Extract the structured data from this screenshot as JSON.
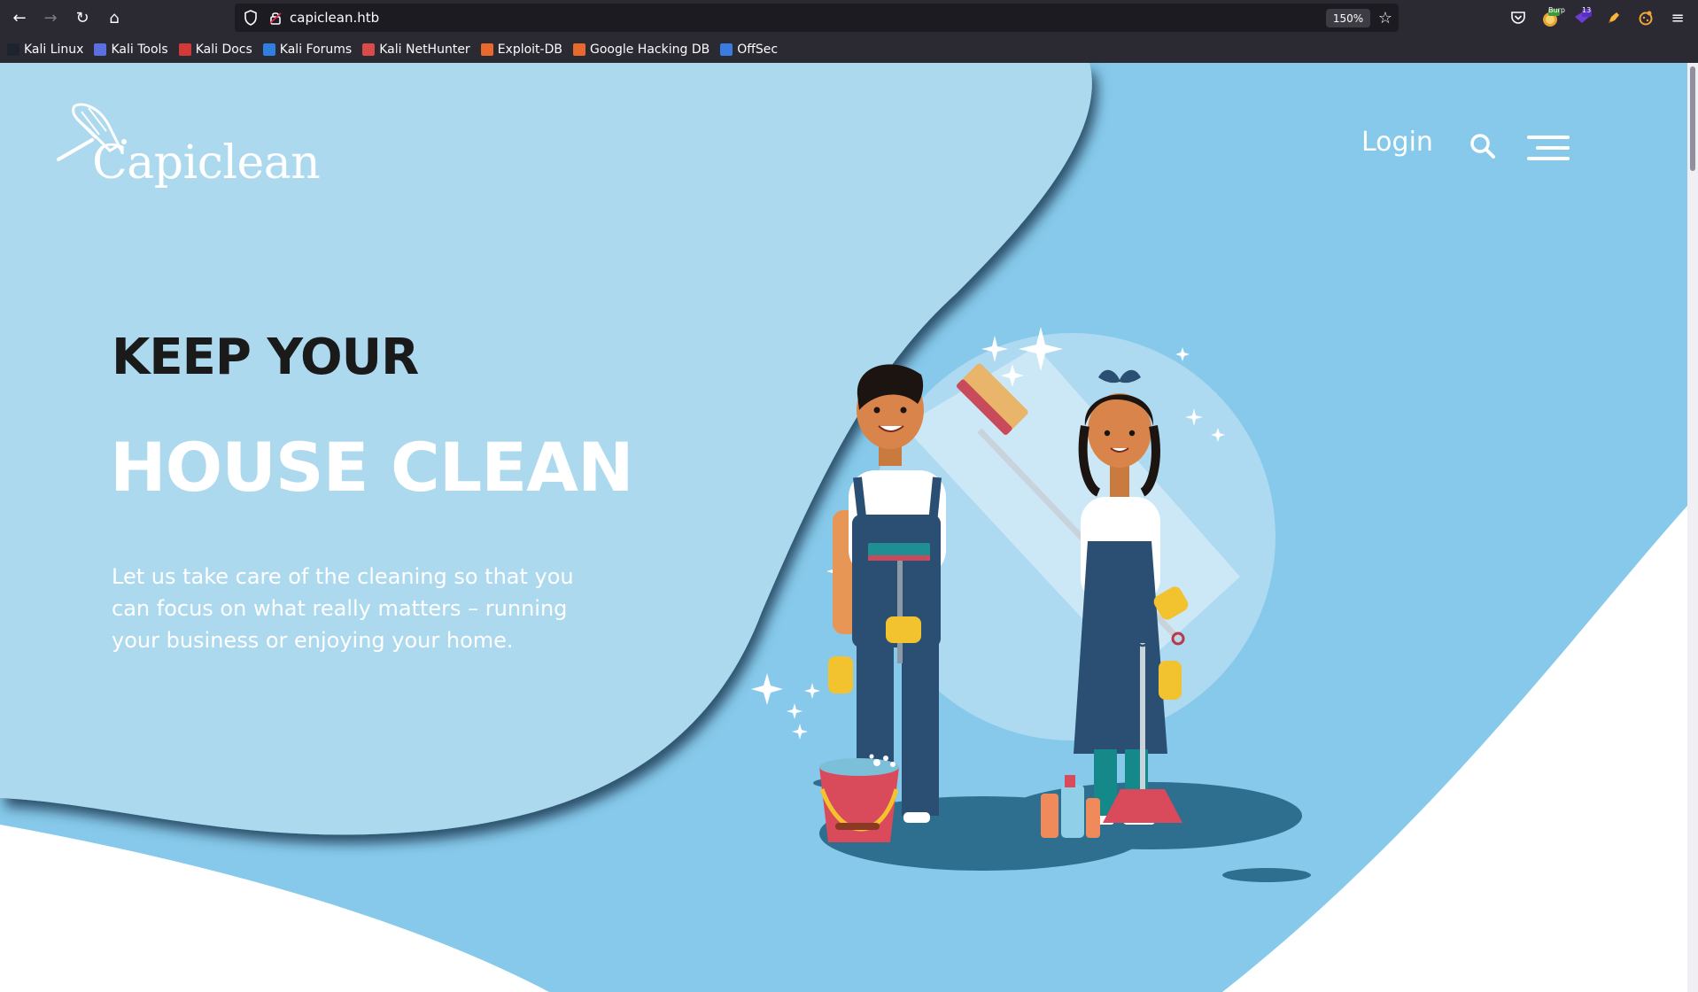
{
  "browser": {
    "url": "capiclean.htb",
    "zoom": "150%",
    "extensions": [
      {
        "name": "pocket-icon"
      },
      {
        "name": "burp-extension-icon",
        "badge": "Burp"
      },
      {
        "name": "extension-badge-icon",
        "badge": "13"
      },
      {
        "name": "pencil-extension-icon"
      },
      {
        "name": "cookie-extension-icon"
      }
    ],
    "bookmarks": [
      {
        "label": "Kali Linux",
        "color": "#2d6cdf"
      },
      {
        "label": "Kali Tools",
        "color": "#5a6fe0"
      },
      {
        "label": "Kali Docs",
        "color": "#d23a3a"
      },
      {
        "label": "Kali Forums",
        "color": "#2f7fe0"
      },
      {
        "label": "Kali NetHunter",
        "color": "#d94a4a"
      },
      {
        "label": "Exploit-DB",
        "color": "#e8692e"
      },
      {
        "label": "Google Hacking DB",
        "color": "#e8692e"
      },
      {
        "label": "OffSec",
        "color": "#3a7be0"
      }
    ]
  },
  "page": {
    "logo_text": "Capiclean",
    "nav": {
      "login_label": "Login"
    },
    "hero": {
      "line1": "KEEP YOUR",
      "line2": "HOUSE CLEAN",
      "description": "Let us take care of the cleaning so that you can focus on what really matters – running your business or enjoying your home."
    }
  },
  "colors": {
    "bg_light": "#acd9ee",
    "bg_mid": "#87c9ea",
    "heading_dark": "#1a1a1a",
    "white": "#ffffff"
  }
}
